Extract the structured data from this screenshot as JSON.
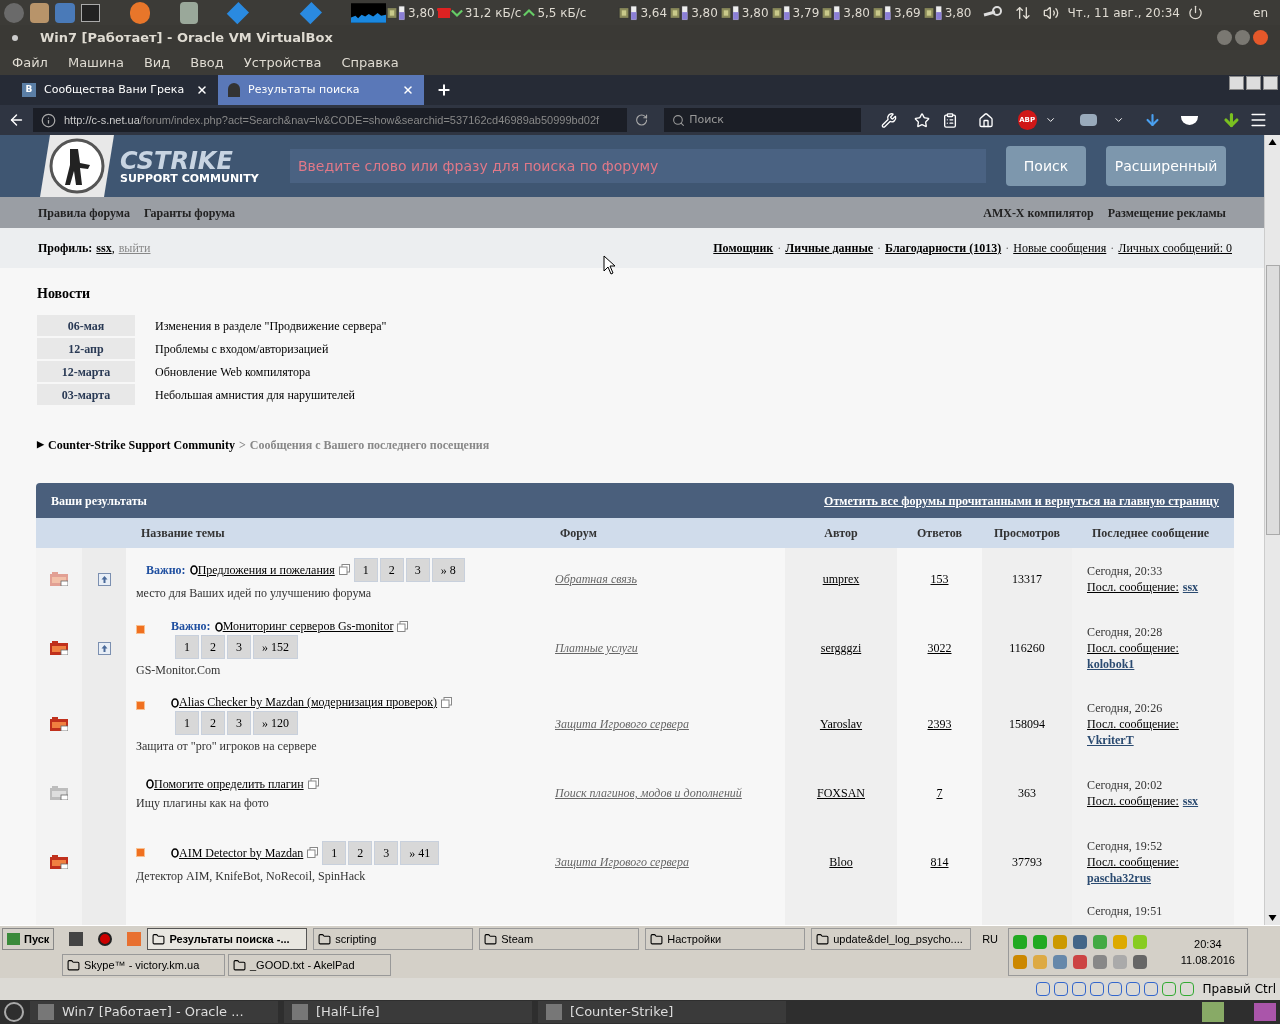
{
  "top_panel": {
    "cpu_readings": [
      "3,80",
      "3,64",
      "3,80",
      "3,80",
      "3,79",
      "3,80",
      "3,69",
      "3,80"
    ],
    "net_down": "31,2 кБ/с",
    "net_up": "5,5 кБ/с",
    "clock": "Чт., 11 авг., 20:34",
    "lang": "en"
  },
  "vbox_window": {
    "title": "Win7 [Работает] - Oracle VM VirtualBox",
    "menu": [
      "Файл",
      "Машина",
      "Вид",
      "Ввод",
      "Устройства",
      "Справка"
    ]
  },
  "browser": {
    "tabs": [
      {
        "label": "Сообщества Вани Грека",
        "favicon": "В",
        "selected": false
      },
      {
        "label": "Результаты поиска",
        "selected": true
      }
    ],
    "url_host": "http://c-s.net.ua",
    "url_path": "/forum/index.php?act=Search&nav=lv&CODE=show&searchid=537162cd46989ab50999bd02f",
    "search_placeholder": "Поиск",
    "abp_badge": "ABP"
  },
  "forum": {
    "logo": "CSTRIKE",
    "logo_sub": "SUPPORT COMMUNITY",
    "search_placeholder": "Введите слово или фразу для поиска по форуму",
    "search_button": "Поиск",
    "advanced_button": "Расширенный",
    "nav_left": [
      "Правила форума",
      "Гаранты форума"
    ],
    "nav_right": [
      "AMX-X компилятор",
      "Размещение рекламы"
    ],
    "profile": {
      "label": "Профиль:",
      "user": "ssx",
      "separator": ",",
      "logout": "выйти"
    },
    "user_links": [
      {
        "label": "Помощник",
        "bold": true
      },
      {
        "sep": "·",
        "label": "Личные данные",
        "bold": true
      },
      {
        "sep": "·",
        "label": "Благодарности (1013)",
        "bold": true
      },
      {
        "sep": "·",
        "label": "Новые сообщения",
        "bold": false
      },
      {
        "sep": "·",
        "label": "Личных сообщений: 0",
        "bold": false
      }
    ],
    "news": {
      "title": "Новости",
      "items": [
        {
          "date": "06-мая",
          "text": "Изменения в разделе \"Продвижение сервера\""
        },
        {
          "date": "12-апр",
          "text": "Проблемы с входом/авторизацией"
        },
        {
          "date": "12-марта",
          "text": "Обновление Web компилятора"
        },
        {
          "date": "03-марта",
          "text": "Небольшая амнистия для нарушителей"
        }
      ]
    },
    "breadcrumb": {
      "arrow": "▶",
      "root": "Counter-Strike Support Community",
      "separator": ">",
      "current": "Сообщения с Вашего последнего посещения"
    },
    "results": {
      "title": "Ваши результаты",
      "mark_read": "Отметить все форумы прочитанными и вернуться на главную страницу",
      "columns": [
        "Название темы",
        "Форум",
        "Автор",
        "Ответов",
        "Просмотров",
        "Последнее сообщение"
      ],
      "rows": [
        {
          "hot": true,
          "read": true,
          "pinned": true,
          "has_new": false,
          "prefix": "Важно:",
          "title": "Предложения и пожелания",
          "pages": [
            "1",
            "2",
            "3",
            "» 8"
          ],
          "description": "место для Ваших идей по улучшению форума",
          "forum": "Обратная связь",
          "author": "umprex",
          "replies": "153",
          "views": "13317",
          "last_date": "Сегодня, 20:33",
          "last_label": "Посл. сообщение:",
          "last_user": "ssx"
        },
        {
          "hot": true,
          "read": false,
          "pinned": true,
          "has_new": true,
          "prefix": "Важно:",
          "title": "Мониторинг серверов Gs-monitor",
          "pages": [
            "1",
            "2",
            "3",
            "» 152"
          ],
          "description": "GS-Monitor.Com",
          "forum": "Платные услуги",
          "author": "sergggzi",
          "replies": "3022",
          "views": "116260",
          "last_date": "Сегодня, 20:28",
          "last_label": "Посл. сообщение:",
          "last_user": "kolobok1"
        },
        {
          "hot": true,
          "read": false,
          "pinned": false,
          "has_new": true,
          "title": "Alias Checker by Mazdan (модернизация проверок)",
          "pages": [
            "1",
            "2",
            "3",
            "» 120"
          ],
          "description": "Защита от \"pro\" игроков на сервере",
          "forum": "Защита Игрового сервера",
          "author": "Yaroslav",
          "replies": "2393",
          "views": "158094",
          "last_date": "Сегодня, 20:26",
          "last_label": "Посл. сообщение:",
          "last_user": "VkriterT"
        },
        {
          "hot": false,
          "read": true,
          "pinned": false,
          "has_new": false,
          "title": "Помогите определить плагин",
          "pages": [],
          "description": "Ищу плагины как на фото",
          "forum": "Поиск плагинов, модов и дополнений",
          "author": "FOXSAN",
          "replies": "7",
          "views": "363",
          "last_date": "Сегодня, 20:02",
          "last_label": "Посл. сообщение:",
          "last_user": "ssx"
        },
        {
          "hot": true,
          "read": false,
          "pinned": false,
          "has_new": true,
          "title": "AIM Detector by Mazdan",
          "pages": [
            "1",
            "2",
            "3",
            "» 41"
          ],
          "description": "Детектор AIM, KnifeBot, NoRecoil, SpinHack",
          "forum": "Защита Игрового сервера",
          "author": "Bloo",
          "replies": "814",
          "views": "37793",
          "last_date": "Сегодня, 19:52",
          "last_label": "Посл. сообщение:",
          "last_user": "pascha32rus"
        },
        {
          "last_date": "Сегодня, 19:51"
        }
      ]
    }
  },
  "win_taskbar": {
    "start": "Пуск",
    "tasks": [
      {
        "label": "Результаты поиска -...",
        "selected": true
      },
      {
        "label": "scripting",
        "selected": false
      },
      {
        "label": "Steam",
        "selected": false
      },
      {
        "label": "Настройки",
        "selected": false
      },
      {
        "label": "update&del_log_psycho....",
        "selected": false
      },
      {
        "label": "Skype™ - victory.km.ua",
        "selected": false
      },
      {
        "label": "_GOOD.txt - AkelPad",
        "selected": false
      }
    ],
    "lang": "RU",
    "time": "20:34",
    "date": "11.08.2016"
  },
  "vbox_status": {
    "host_key": "Правый Ctrl"
  },
  "host_taskbar": {
    "items": [
      "Win7 [Работает] - Oracle ...",
      "[Half-Life]",
      "[Counter-Strike]"
    ]
  }
}
